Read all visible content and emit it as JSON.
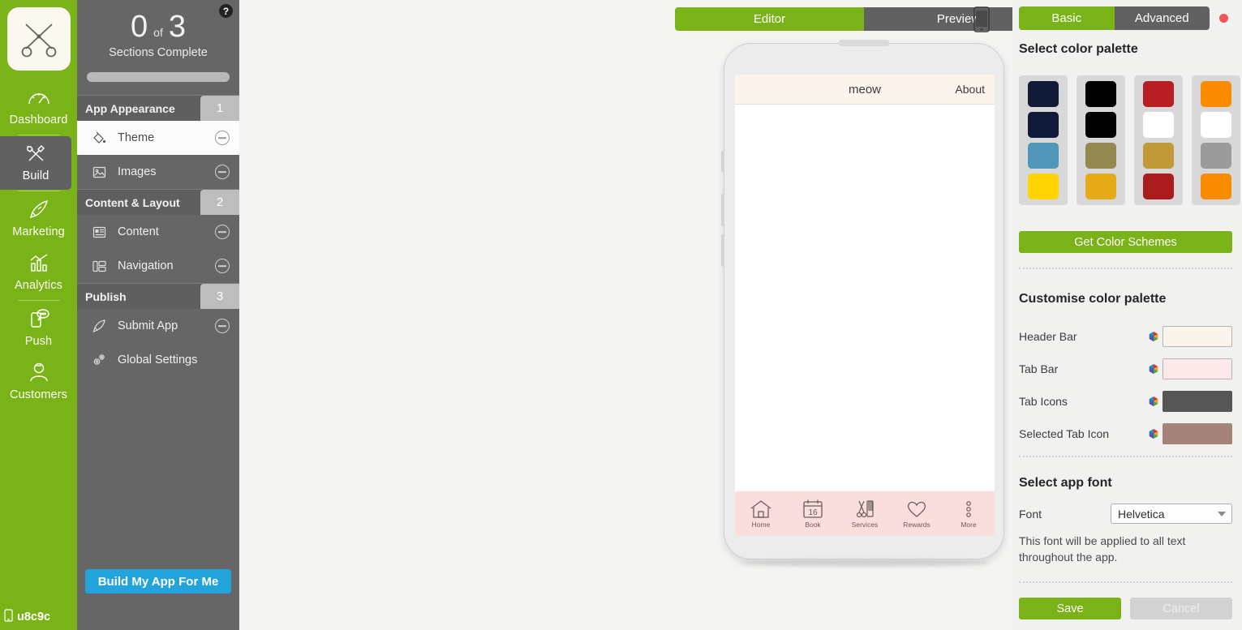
{
  "rail": {
    "logo_icon": "scissors-logo-icon",
    "items": [
      {
        "label": "Dashboard",
        "icon": "gauge-icon",
        "active": false
      },
      {
        "label": "Build",
        "icon": "tools-icon",
        "active": true
      },
      {
        "label": "Marketing",
        "icon": "rocket-icon",
        "active": false
      },
      {
        "label": "Analytics",
        "icon": "bar-chart-icon",
        "active": false
      },
      {
        "label": "Push",
        "icon": "push-notification-icon",
        "active": false
      },
      {
        "label": "Customers",
        "icon": "user-icon",
        "active": false
      }
    ],
    "footer_label": "u8c9c",
    "footer_icon": "mobile-icon",
    "bg_color": "#7ab317"
  },
  "panel": {
    "help_icon_label": "?",
    "progress": {
      "completed": "0",
      "of_label": "of",
      "total": "3",
      "caption": "Sections Complete",
      "percent": 0
    },
    "sections": [
      {
        "title": "App Appearance",
        "number": "1",
        "items": [
          {
            "label": "Theme",
            "icon": "paint-bucket-icon",
            "active": true,
            "has_minus": true
          },
          {
            "label": "Images",
            "icon": "image-icon",
            "active": false,
            "has_minus": true
          }
        ]
      },
      {
        "title": "Content & Layout",
        "number": "2",
        "items": [
          {
            "label": "Content",
            "icon": "content-list-icon",
            "active": false,
            "has_minus": true
          },
          {
            "label": "Navigation",
            "icon": "layout-columns-icon",
            "active": false,
            "has_minus": true
          }
        ]
      },
      {
        "title": "Publish",
        "number": "3",
        "items": [
          {
            "label": "Submit App",
            "icon": "rocket-icon",
            "active": false,
            "has_minus": true
          },
          {
            "label": "Global Settings",
            "icon": "gears-icon",
            "active": false,
            "has_minus": false
          }
        ]
      }
    ],
    "build_button_label": "Build My App For Me",
    "build_button_color": "#23a3dc"
  },
  "stage": {
    "tabs": [
      {
        "label": "Editor",
        "active": true
      },
      {
        "label": "Preview",
        "active": false
      }
    ],
    "device_toggle_icon": "mobile-device-icon",
    "phone": {
      "header": {
        "title": "meow",
        "right_action": "About",
        "bg_color": "#faf4ec"
      },
      "body_color": "#ffffff",
      "tabbar": {
        "bg_color": "#fadedd",
        "tabs": [
          {
            "label": "Home",
            "icon": "home-icon"
          },
          {
            "label": "Book",
            "icon": "calendar-icon",
            "day": "16"
          },
          {
            "label": "Services",
            "icon": "scissors-comb-icon"
          },
          {
            "label": "Rewards",
            "icon": "heart-icon"
          },
          {
            "label": "More",
            "icon": "more-dots-icon"
          }
        ]
      }
    }
  },
  "right": {
    "tabs": [
      {
        "label": "Basic",
        "active": true
      },
      {
        "label": "Advanced",
        "active": false
      }
    ],
    "record_dot_color": "#f4535a",
    "palette_heading": "Select color palette",
    "palettes": [
      {
        "name": "palette-navy-blue-yellow",
        "swatches": [
          "#111a36",
          "#101a38",
          "#5096b8",
          "#ffd400"
        ]
      },
      {
        "name": "palette-black-olive-gold",
        "swatches": [
          "#000000",
          "#000000",
          "#93884f",
          "#e5aa17"
        ]
      },
      {
        "name": "palette-red-white-gold",
        "swatches": [
          "#b91f22",
          "#ffffff",
          "#c29939",
          "#ab1c1f"
        ]
      },
      {
        "name": "palette-orange-white-gray",
        "swatches": [
          "#fb8c00",
          "#ffffff",
          "#9b9b9b",
          "#fb8c00"
        ]
      }
    ],
    "get_schemes_label": "Get Color Schemes",
    "customise_heading": "Customise color palette",
    "color_rows": [
      {
        "label": "Header Bar",
        "value": "#faf4ec"
      },
      {
        "label": "Tab Bar",
        "value": "#fde9e9"
      },
      {
        "label": "Tab Icons",
        "value": "#565656"
      },
      {
        "label": "Selected Tab Icon",
        "value": "#a5827a"
      }
    ],
    "font_heading": "Select app font",
    "font_label": "Font",
    "font_value": "Helvetica",
    "font_note": "This font will be applied to all text throughout the app.",
    "save_label": "Save",
    "cancel_label": "Cancel"
  }
}
